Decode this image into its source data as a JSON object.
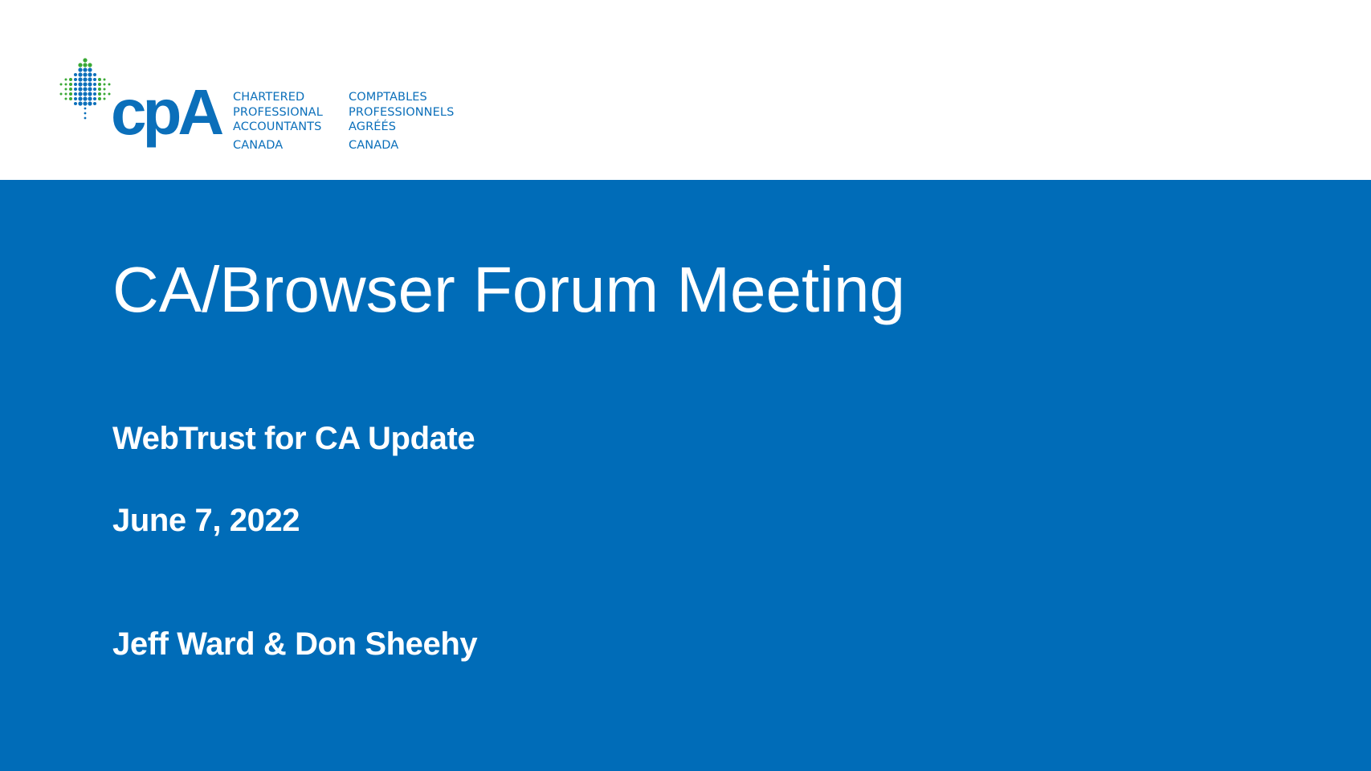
{
  "brand": {
    "wordmark": "cpA",
    "english_lines": [
      "CHARTERED",
      "PROFESSIONAL",
      "ACCOUNTANTS",
      "CANADA"
    ],
    "french_lines": [
      "COMPTABLES",
      "PROFESSIONNELS",
      "AGRÉÉS",
      "CANADA"
    ],
    "icon": "maple-leaf-dots-icon",
    "colors": {
      "primary_blue": "#0b6fba",
      "leaf_green": "#3aa935",
      "leaf_blue": "#0b6fba"
    }
  },
  "slide": {
    "title": "CA/Browser Forum Meeting",
    "subtitle": "WebTrust for CA Update",
    "date": "June 7, 2022",
    "presenters": "Jeff Ward & Don Sheehy",
    "background_color": "#006cb8",
    "text_color": "#ffffff"
  }
}
